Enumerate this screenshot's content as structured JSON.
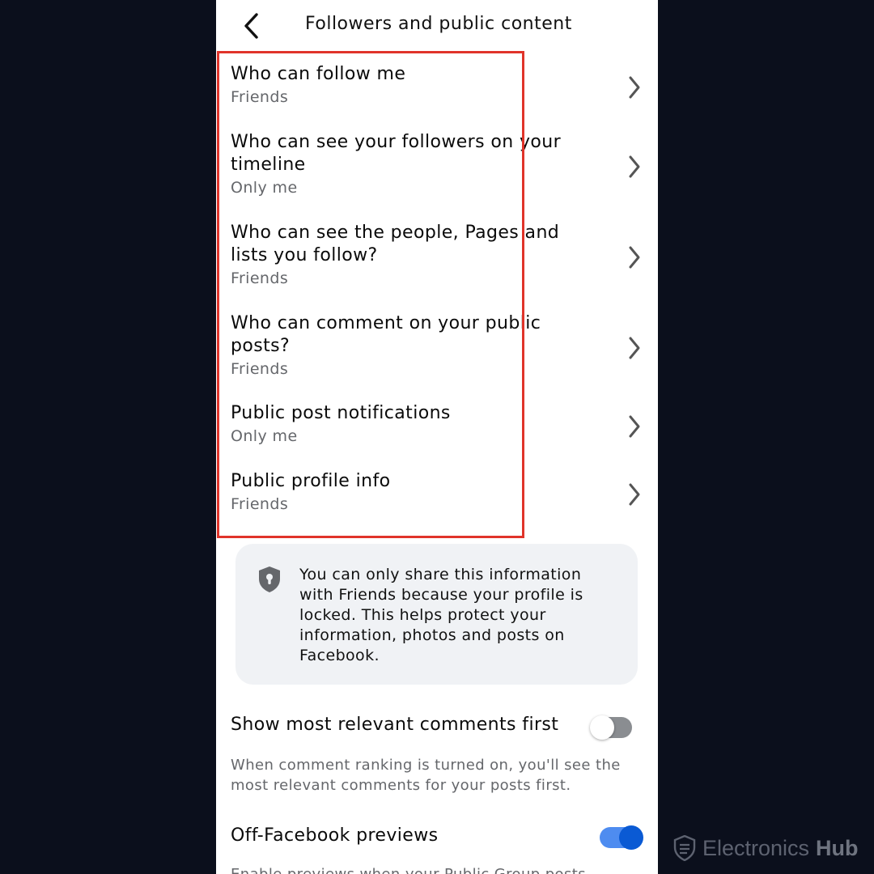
{
  "header": {
    "title": "Followers and public content"
  },
  "rows": [
    {
      "label": "Who can follow me",
      "value": "Friends"
    },
    {
      "label": "Who can see your followers on your timeline",
      "value": "Only me"
    },
    {
      "label": "Who can see the people, Pages and lists you follow?",
      "value": "Friends"
    },
    {
      "label": "Who can comment on your public posts?",
      "value": "Friends"
    },
    {
      "label": "Public post notifications",
      "value": "Only me"
    },
    {
      "label": "Public profile info",
      "value": "Friends"
    }
  ],
  "info_card": {
    "icon": "shield-lock-icon",
    "text": "You can only share this information with Friends because your profile is locked. This helps protect your information, photos and posts on Facebook."
  },
  "settings": [
    {
      "title": "Show most relevant comments first",
      "description": "When comment ranking is turned on, you'll see the most relevant comments for your posts first.",
      "enabled": false
    },
    {
      "title": "Off-Facebook previews",
      "description": "Enable previews when your Public Group posts",
      "enabled": true
    }
  ],
  "watermark": {
    "part1": "Electronics",
    "part2": "Hub",
    "icon": "shield-logo-icon"
  },
  "colors": {
    "highlight": "#e0342a",
    "toggle_on": "#0a5ad4",
    "background": "#0b0f1c"
  }
}
